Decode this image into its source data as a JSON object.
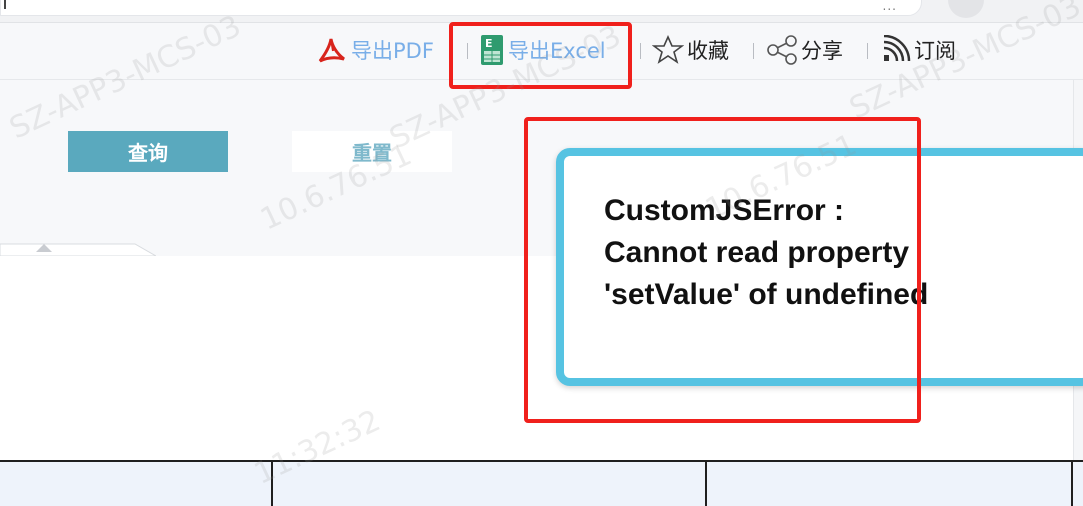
{
  "toolbar": {
    "export_pdf": "导出PDF",
    "export_excel": "导出Excel",
    "favorite": "收藏",
    "share": "分享",
    "subscribe": "订阅",
    "link_color": "#79aee8",
    "text_color": "#222222"
  },
  "chrome": {
    "url_tail": "..."
  },
  "query": {
    "search_label": "查询",
    "reset_label": "重置"
  },
  "error": {
    "message": "CustomJSError : Cannot read property 'setValue' of undefined"
  },
  "watermark": {
    "host": "SZ-APP3-MCS-03",
    "ip": "10.6.76.51",
    "time": "11:32:32"
  },
  "colors": {
    "query_button": "#5aa9be",
    "dialog_border": "#56c3e2",
    "annotation": "#f0201c"
  },
  "icons": [
    "pdf-icon",
    "excel-icon",
    "star-icon",
    "share-icon",
    "rss-icon"
  ]
}
